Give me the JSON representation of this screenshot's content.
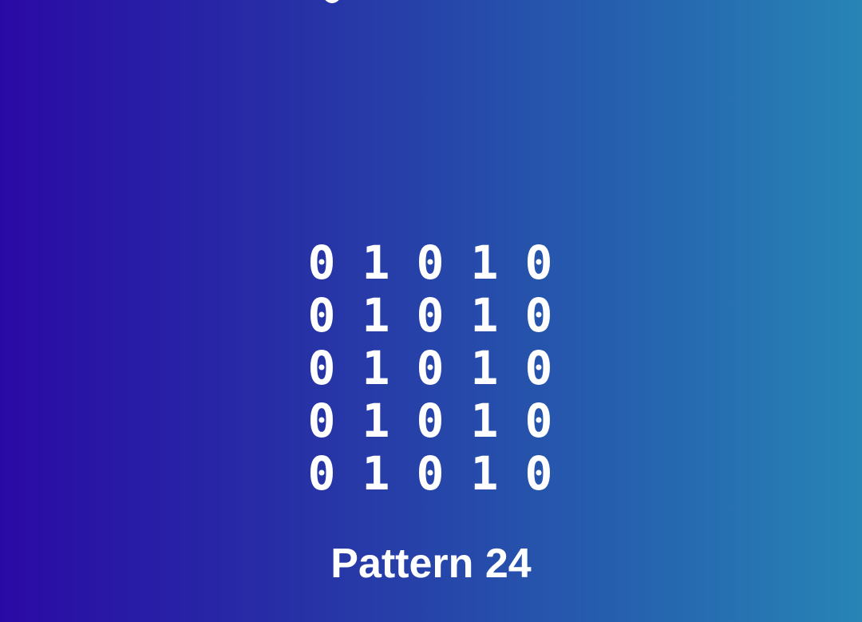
{
  "pattern": {
    "rows": [
      [
        "0",
        "1",
        "0",
        "1",
        "0"
      ],
      [
        "0",
        "1",
        "0",
        "1",
        "0"
      ],
      [
        "0",
        "1",
        "0",
        "1",
        "0"
      ],
      [
        "0",
        "1",
        "0",
        "1",
        "0"
      ],
      [
        "0",
        "1",
        "0",
        "1",
        "0"
      ]
    ],
    "caption": "Pattern 24"
  },
  "colors": {
    "gradient_start": "#2a0aa5",
    "gradient_end": "#2784b5",
    "text": "#ffffff"
  }
}
